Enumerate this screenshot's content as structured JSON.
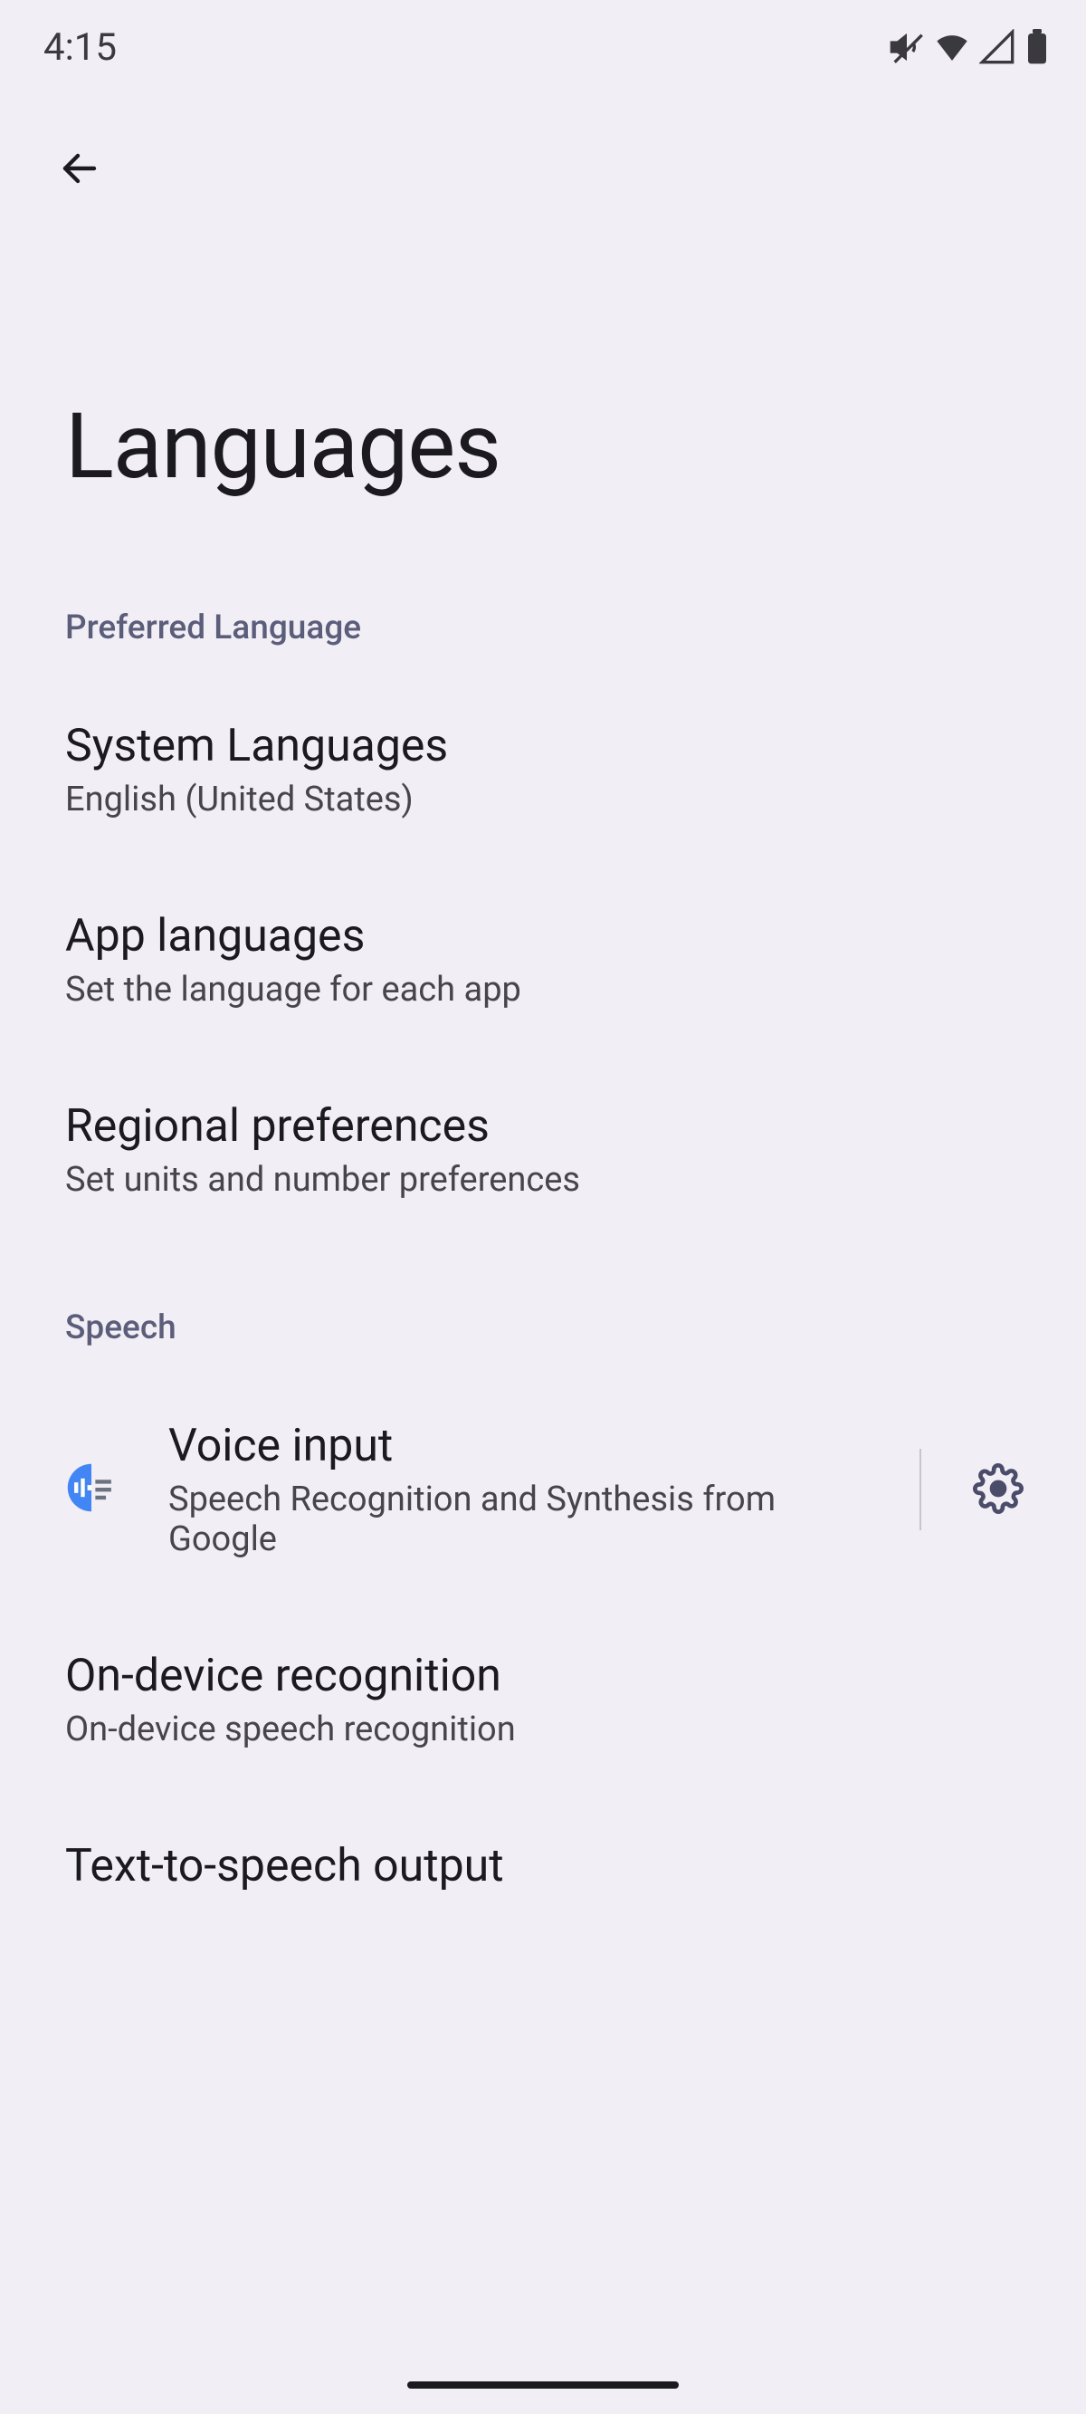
{
  "status": {
    "time": "4:15"
  },
  "header": {
    "title": "Languages"
  },
  "sections": {
    "preferred": {
      "label": "Preferred Language",
      "system_languages": {
        "title": "System Languages",
        "sub": "English (United States)"
      },
      "app_languages": {
        "title": "App languages",
        "sub": "Set the language for each app"
      },
      "regional": {
        "title": "Regional preferences",
        "sub": "Set units and number preferences"
      }
    },
    "speech": {
      "label": "Speech",
      "voice_input": {
        "title": "Voice input",
        "sub": "Speech Recognition and Synthesis from Google"
      },
      "on_device": {
        "title": "On-device recognition",
        "sub": "On-device speech recognition"
      },
      "tts": {
        "title": "Text-to-speech output"
      }
    }
  }
}
